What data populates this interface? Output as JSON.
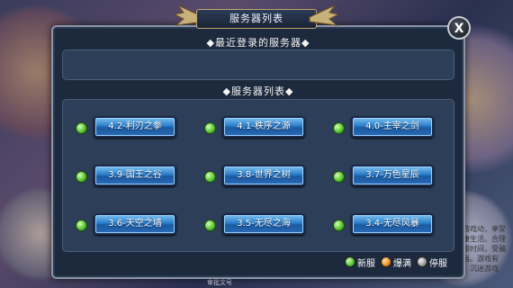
{
  "window": {
    "title": "服务器列表",
    "close_label": "X"
  },
  "recent": {
    "label": "◆最近登录的服务器◆"
  },
  "server_list": {
    "label": "◆服务器列表◆",
    "servers": [
      {
        "name": "4.2-利刃之拳",
        "status": "new"
      },
      {
        "name": "4.1-秩序之源",
        "status": "new"
      },
      {
        "name": "4.0-主宰之剑",
        "status": "new"
      },
      {
        "name": "3.9-国王之谷",
        "status": "new"
      },
      {
        "name": "3.8-世界之树",
        "status": "new"
      },
      {
        "name": "3.7-万色星辰",
        "status": "new"
      },
      {
        "name": "3.6-天空之墙",
        "status": "new"
      },
      {
        "name": "3.5-无尽之海",
        "status": "new"
      },
      {
        "name": "3.4-无尽风暴",
        "status": "new"
      }
    ]
  },
  "legend": {
    "new_label": "新服",
    "full_label": "爆满",
    "stop_label": "停服"
  },
  "background": {
    "side_text": "活游戏动，享受健康生活。合理安排时间，受骗上当。游戏有益，沉迷游戏",
    "bottom_text": "审批文号"
  },
  "colors": {
    "panel_bg": "#1d2a3d",
    "button_blue": "#2a7cc8",
    "status_new": "#4fc02a",
    "status_full": "#f08a20",
    "status_stop": "#9a9a9a"
  }
}
